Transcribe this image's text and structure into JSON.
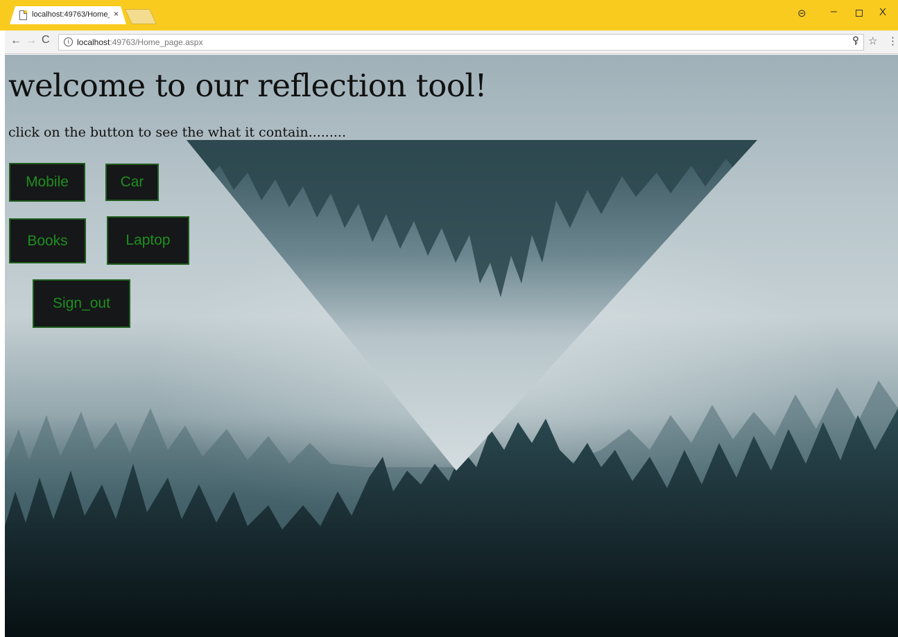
{
  "browser": {
    "tab_title": "localhost:49763/Home_p",
    "tab_close": "×",
    "url_host": "localhost",
    "url_rest": ":49763/Home_page.aspx",
    "info_glyph": "i",
    "icons": [
      "page-icon",
      "close-icon",
      "user-icon",
      "minimize-icon",
      "maximize-icon",
      "window-close-icon",
      "back-icon",
      "forward-icon",
      "reload-icon",
      "info-icon",
      "key-icon",
      "star-icon",
      "menu-icon"
    ],
    "window_controls": {
      "user": "⊝",
      "minimize": "–",
      "close": "X"
    },
    "nav": {
      "back": "←",
      "forward": "→",
      "reload": "C"
    },
    "toolbar_icons": {
      "key": "♈",
      "star": "☆",
      "menu": "⋮"
    },
    "accent_color": "#f9cb1f"
  },
  "page": {
    "heading": "welcome to our reflection tool!",
    "subtitle": "click on the button to see the what it contain.........",
    "buttons": {
      "mobile": "Mobile",
      "car": "Car",
      "books": "Books",
      "laptop": "Laptop",
      "sign_out": "Sign_out"
    },
    "button_colors": {
      "background": "#151718",
      "text": "#1f8f1f",
      "border": "#1f5d1f"
    }
  }
}
